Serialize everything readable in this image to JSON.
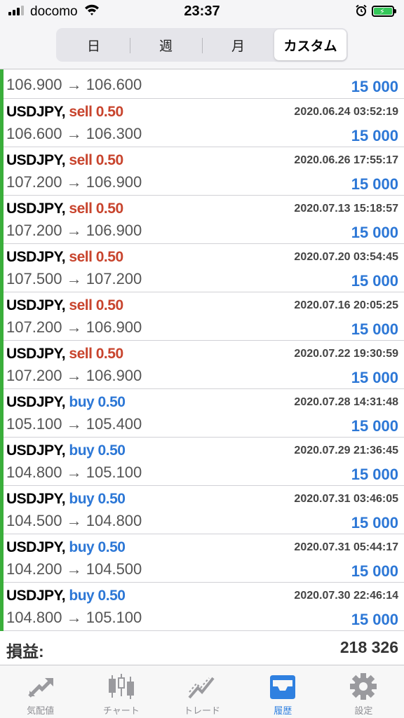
{
  "status_bar": {
    "carrier": "docomo",
    "time": "23:37"
  },
  "segments": [
    "日",
    "週",
    "月",
    "カスタム"
  ],
  "active_segment": "カスタム",
  "partial_row": {
    "prices": "106.900 → 106.600",
    "profit": "15 000"
  },
  "trades": [
    {
      "symbol": "USDJPY,",
      "side": "sell",
      "lot": "sell 0.50",
      "time": "2020.06.24 03:52:19",
      "prices": "106.600 → 106.300",
      "profit": "15 000"
    },
    {
      "symbol": "USDJPY,",
      "side": "sell",
      "lot": "sell 0.50",
      "time": "2020.06.26 17:55:17",
      "prices": "107.200 → 106.900",
      "profit": "15 000"
    },
    {
      "symbol": "USDJPY,",
      "side": "sell",
      "lot": "sell 0.50",
      "time": "2020.07.13 15:18:57",
      "prices": "107.200 → 106.900",
      "profit": "15 000"
    },
    {
      "symbol": "USDJPY,",
      "side": "sell",
      "lot": "sell 0.50",
      "time": "2020.07.20 03:54:45",
      "prices": "107.500 → 107.200",
      "profit": "15 000"
    },
    {
      "symbol": "USDJPY,",
      "side": "sell",
      "lot": "sell 0.50",
      "time": "2020.07.16 20:05:25",
      "prices": "107.200 → 106.900",
      "profit": "15 000"
    },
    {
      "symbol": "USDJPY,",
      "side": "sell",
      "lot": "sell 0.50",
      "time": "2020.07.22 19:30:59",
      "prices": "107.200 → 106.900",
      "profit": "15 000"
    },
    {
      "symbol": "USDJPY,",
      "side": "buy",
      "lot": "buy 0.50",
      "time": "2020.07.28 14:31:48",
      "prices": "105.100 → 105.400",
      "profit": "15 000"
    },
    {
      "symbol": "USDJPY,",
      "side": "buy",
      "lot": "buy 0.50",
      "time": "2020.07.29 21:36:45",
      "prices": "104.800 → 105.100",
      "profit": "15 000"
    },
    {
      "symbol": "USDJPY,",
      "side": "buy",
      "lot": "buy 0.50",
      "time": "2020.07.31 03:46:05",
      "prices": "104.500 → 104.800",
      "profit": "15 000"
    },
    {
      "symbol": "USDJPY,",
      "side": "buy",
      "lot": "buy 0.50",
      "time": "2020.07.31 05:44:17",
      "prices": "104.200 → 104.500",
      "profit": "15 000"
    },
    {
      "symbol": "USDJPY,",
      "side": "buy",
      "lot": "buy 0.50",
      "time": "2020.07.30 22:46:14",
      "prices": "104.800 → 105.100",
      "profit": "15 000"
    }
  ],
  "summary": {
    "label": "損益:",
    "value": "218 326"
  },
  "tabs": [
    {
      "label": "気配値",
      "icon": "quotes-arrows-icon"
    },
    {
      "label": "チャート",
      "icon": "candlestick-chart-icon"
    },
    {
      "label": "トレード",
      "icon": "trade-line-icon"
    },
    {
      "label": "履歴",
      "icon": "history-inbox-icon"
    },
    {
      "label": "設定",
      "icon": "settings-gear-icon"
    }
  ],
  "active_tab": "履歴",
  "colors": {
    "sell": "#c8442d",
    "buy": "#2c77d6",
    "profit": "#2c77d6",
    "indicator_bar": "#3aae3a",
    "active_tab": "#2f80e0",
    "battery": "#34c759"
  }
}
